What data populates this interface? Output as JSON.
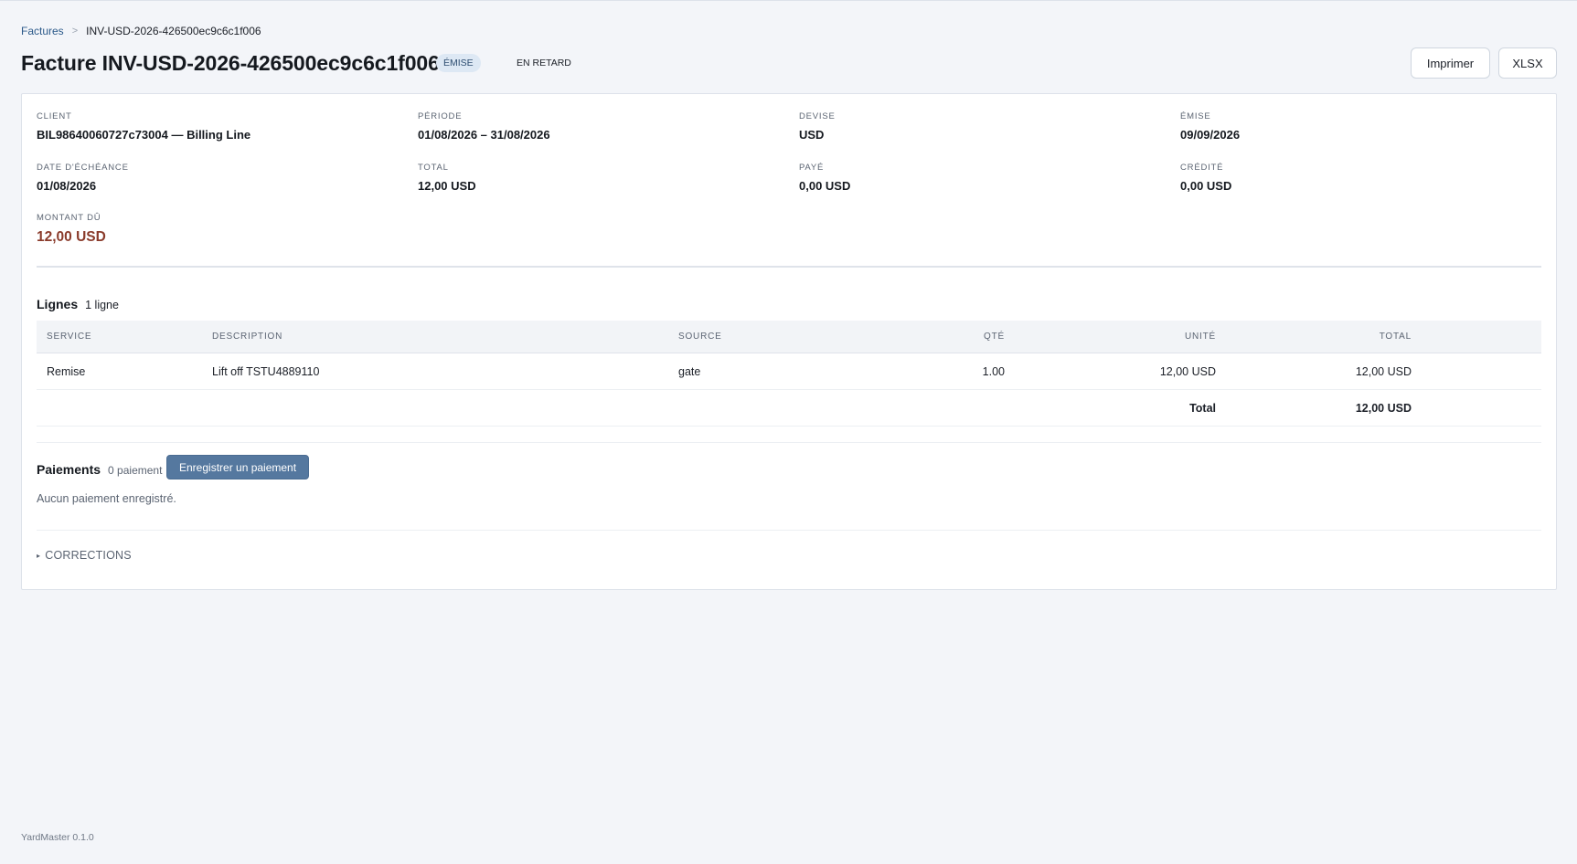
{
  "breadcrumb": {
    "parent": "Factures",
    "separator": ">",
    "current": "INV-USD-2026-426500ec9c6c1f006"
  },
  "header": {
    "title": "Facture INV-USD-2026-426500ec9c6c1f006",
    "status_badge": "ÉMISE",
    "late_badge": "EN RETARD",
    "print_label": "Imprimer",
    "xlsx_label": "XLSX"
  },
  "summary": {
    "client_label": "CLIENT",
    "client_value": "BIL98640060727c73004 — Billing Line",
    "period_label": "PÉRIODE",
    "period_value": "01/08/2026 – 31/08/2026",
    "currency_label": "DEVISE",
    "currency_value": "USD",
    "issued_label": "ÉMISE",
    "issued_value": "09/09/2026",
    "due_date_label": "DATE D'ÉCHÉANCE",
    "due_date_value": "01/08/2026",
    "total_label": "TOTAL",
    "total_value": "12,00 USD",
    "paid_label": "PAYÉ",
    "paid_value": "0,00 USD",
    "credited_label": "CRÉDITÉ",
    "credited_value": "0,00 USD",
    "amount_due_label": "MONTANT DÛ",
    "amount_due_value": "12,00 USD"
  },
  "lines": {
    "heading": "Lignes",
    "count": "1 ligne",
    "columns": {
      "service": "SERVICE",
      "description": "DESCRIPTION",
      "source": "SOURCE",
      "qty": "QTÉ",
      "unit": "UNITÉ",
      "total": "TOTAL"
    },
    "rows": [
      {
        "service": "Remise",
        "description": "Lift off TSTU4889110",
        "source": "gate",
        "qty": "1.00",
        "unit": "12,00 USD",
        "total": "12,00 USD"
      }
    ],
    "footer_label": "Total",
    "footer_total": "12,00 USD"
  },
  "payments": {
    "heading": "Paiements",
    "count": "0 paiement",
    "record_button": "Enregistrer un paiement",
    "empty_text": "Aucun paiement enregistré."
  },
  "corrections": {
    "label": "CORRECTIONS",
    "caret": "▸"
  },
  "footer": {
    "version": "YardMaster 0.1.0"
  },
  "colors": {
    "accent_button": "#55789f",
    "amount_due": "#8a3b2b",
    "link": "#2c5a8a",
    "badge_bg": "#dde8f4"
  }
}
